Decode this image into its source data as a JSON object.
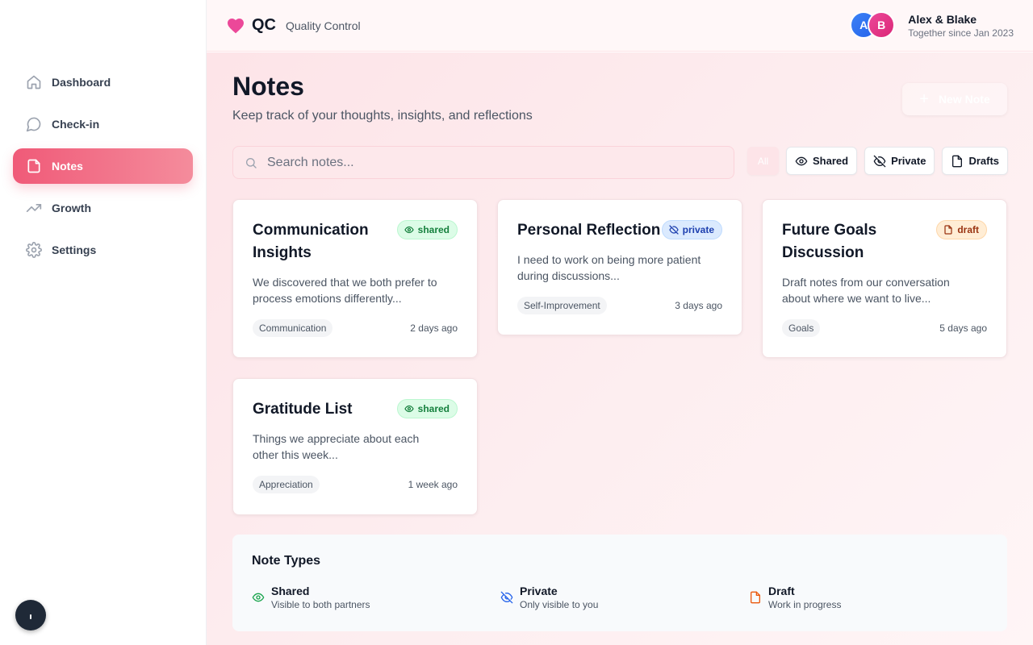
{
  "app": {
    "logo": "QC",
    "tagline": "Quality Control",
    "brand_color": "#ec4899"
  },
  "user": {
    "avatar_a": "A",
    "avatar_b": "B",
    "names": "Alex & Blake",
    "since": "Together since Jan 2023"
  },
  "sidebar": {
    "items": [
      {
        "label": "Dashboard",
        "icon": "home-icon",
        "active": false
      },
      {
        "label": "Check-in",
        "icon": "chat-bubble-icon",
        "active": false
      },
      {
        "label": "Notes",
        "icon": "note-icon",
        "active": true
      },
      {
        "label": "Growth",
        "icon": "trending-up-icon",
        "active": false
      },
      {
        "label": "Settings",
        "icon": "gear-icon",
        "active": false
      }
    ]
  },
  "page": {
    "title": "Notes",
    "subtitle": "Keep track of your thoughts, insights, and reflections",
    "new_note_label": "New Note"
  },
  "search": {
    "placeholder": "Search notes...",
    "value": ""
  },
  "filters": {
    "all": "All",
    "shared": "Shared",
    "private": "Private",
    "drafts": "Drafts"
  },
  "notes": [
    {
      "title": "Communication Insights",
      "badge": "shared",
      "body": "We discovered that we both prefer to process emotions differently...",
      "tag": "Communication",
      "time": "2 days ago"
    },
    {
      "title": "Personal Reflection",
      "badge": "private",
      "body": "I need to work on being more patient during discussions...",
      "tag": "Self-Improvement",
      "time": "3 days ago"
    },
    {
      "title": "Future Goals Discussion",
      "badge": "draft",
      "body": "Draft notes from our conversation about where we want to live...",
      "tag": "Goals",
      "time": "5 days ago"
    },
    {
      "title": "Gratitude List",
      "badge": "shared",
      "body": "Things we appreciate about each other this week...",
      "tag": "Appreciation",
      "time": "1 week ago"
    }
  ],
  "note_types": {
    "title": "Note Types",
    "items": [
      {
        "name": "Shared",
        "desc": "Visible to both partners",
        "icon": "eye-icon",
        "color": "#16a34a"
      },
      {
        "name": "Private",
        "desc": "Only visible to you",
        "icon": "eye-off-icon",
        "color": "#2563eb"
      },
      {
        "name": "Draft",
        "desc": "Work in progress",
        "icon": "file-icon",
        "color": "#ea580c"
      }
    ]
  }
}
